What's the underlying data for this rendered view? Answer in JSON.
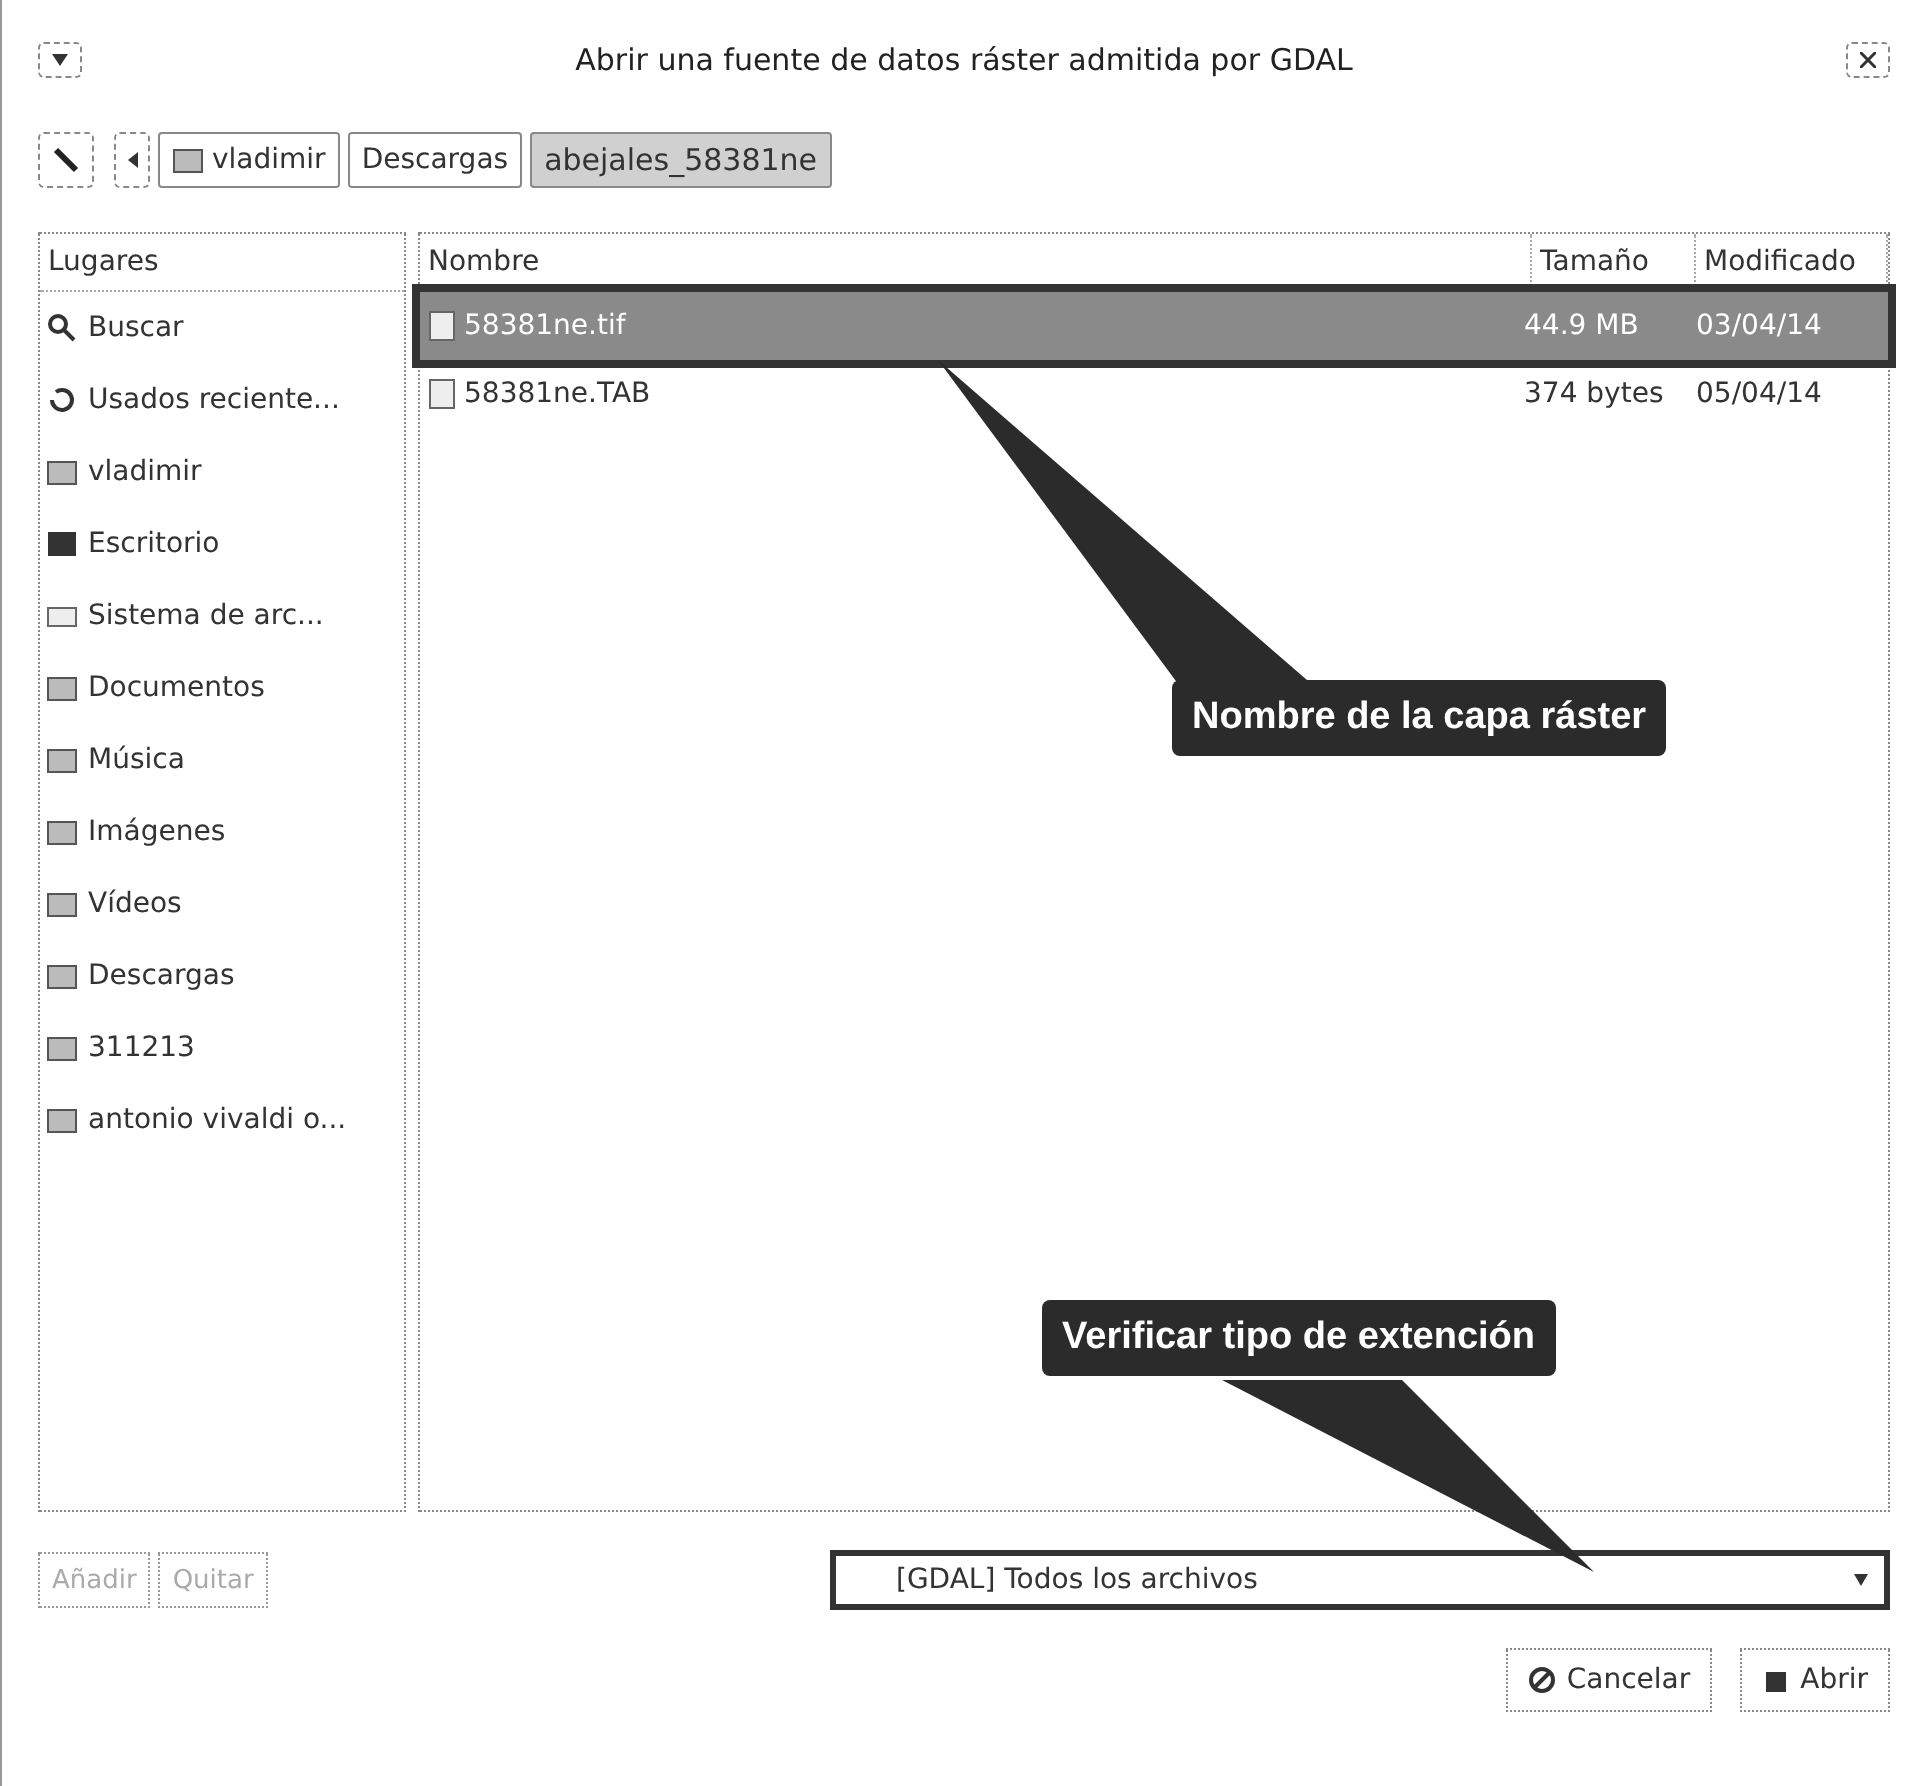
{
  "window": {
    "title": "Abrir una fuente de datos ráster admitida por GDAL"
  },
  "path_bar": [
    {
      "label": "vladimir",
      "icon": true,
      "selected": false
    },
    {
      "label": "Descargas",
      "icon": false,
      "selected": false
    },
    {
      "label": "abejales_58381ne",
      "icon": false,
      "selected": true
    }
  ],
  "sidebar": {
    "header": "Lugares",
    "items": [
      {
        "label": "Buscar",
        "kind": "search"
      },
      {
        "label": "Usados reciente...",
        "kind": "recent"
      },
      {
        "label": "vladimir",
        "kind": "folder"
      },
      {
        "label": "Escritorio",
        "kind": "desktop"
      },
      {
        "label": "Sistema de arc...",
        "kind": "drive"
      },
      {
        "label": "Documentos",
        "kind": "folder"
      },
      {
        "label": "Música",
        "kind": "folder"
      },
      {
        "label": "Imágenes",
        "kind": "folder"
      },
      {
        "label": "Vídeos",
        "kind": "folder"
      },
      {
        "label": "Descargas",
        "kind": "folder"
      },
      {
        "label": "311213",
        "kind": "folder"
      },
      {
        "label": "antonio vivaldi o...",
        "kind": "folder"
      }
    ]
  },
  "file_list": {
    "columns": [
      "Nombre",
      "Tamaño",
      "Modificado"
    ],
    "rows": [
      {
        "name": "58381ne.tif",
        "size": "44.9 MB",
        "modified": "03/04/14",
        "selected": true
      },
      {
        "name": "58381ne.TAB",
        "size": "374 bytes",
        "modified": "05/04/14",
        "selected": false
      }
    ]
  },
  "place_buttons": [
    {
      "label": "Añadir",
      "disabled": true
    },
    {
      "label": "Quitar",
      "disabled": true
    }
  ],
  "filter": {
    "value": "[GDAL] Todos los archivos"
  },
  "buttons": [
    {
      "label": "Cancelar",
      "kind": "cancel"
    },
    {
      "label": "Abrir",
      "kind": "open"
    }
  ],
  "callouts": [
    {
      "text": "Nombre de la capa ráster"
    },
    {
      "text": "Verificar tipo de extención"
    }
  ]
}
